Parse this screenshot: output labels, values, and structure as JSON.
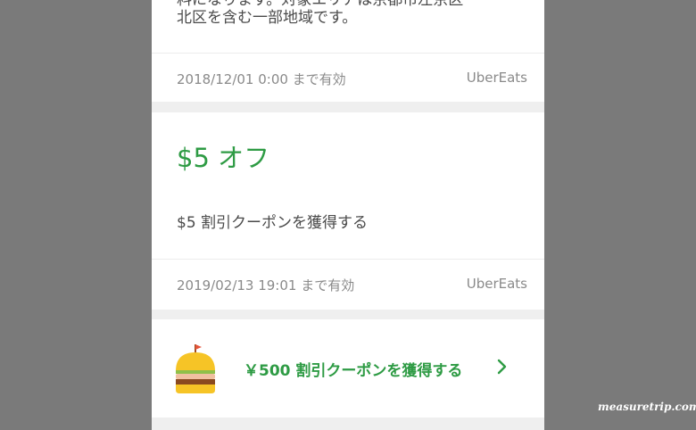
{
  "coupon1": {
    "description_line1": "料になります。対象エリアは京都市左京区",
    "description_line2": "北区を含む一部地域です。",
    "expiry": "2018/12/01 0:00 まで有効",
    "source": "UberEats"
  },
  "coupon2": {
    "title": "$5 オフ",
    "description": "$5 割引クーポンを獲得する",
    "expiry": "2019/02/13 19:01 まで有効",
    "source": "UberEats"
  },
  "promo": {
    "icon": "burger-icon",
    "label": "￥500 割引クーポンを獲得する"
  },
  "watermark": "measuretrip.com",
  "colors": {
    "accent_green": "#2e9b44",
    "background_gray": "#7a7a7a"
  }
}
